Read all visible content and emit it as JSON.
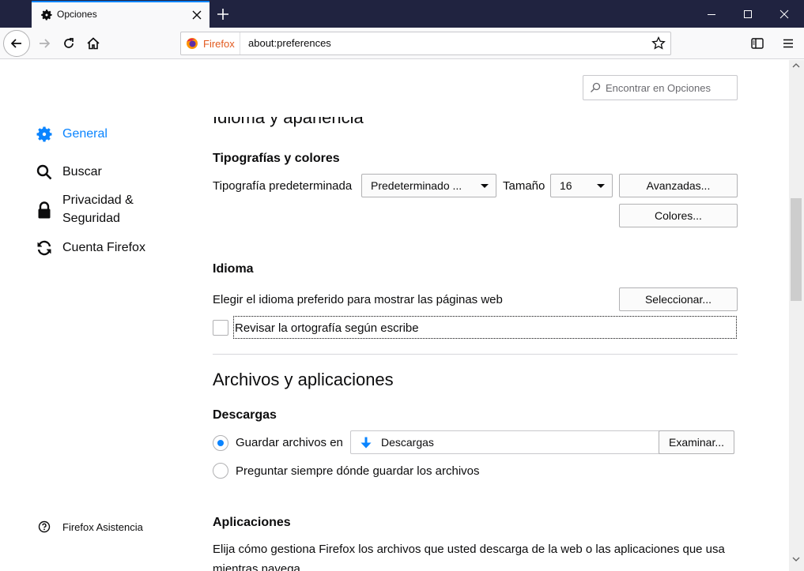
{
  "browser": {
    "tab_title": "Opciones",
    "identity_label": "Firefox",
    "url": "about:preferences"
  },
  "search": {
    "placeholder": "Encontrar en Opciones"
  },
  "sidebar": {
    "items": [
      {
        "label": "General",
        "icon": "gear-icon",
        "active": true
      },
      {
        "label": "Buscar",
        "icon": "search-icon"
      },
      {
        "label": "Privacidad &\nSeguridad",
        "icon": "lock-icon"
      },
      {
        "label": "Cuenta Firefox",
        "icon": "sync-icon"
      }
    ],
    "help_label": "Firefox Asistencia"
  },
  "main": {
    "clipped_heading": "Idioma y apariencia",
    "fonts": {
      "heading": "Tipografías y colores",
      "default_font_label": "Tipografía predeterminada",
      "default_font_value": "Predeterminado ...",
      "size_label": "Tamaño",
      "size_value": "16",
      "advanced_button": "Avanzadas...",
      "colors_button": "Colores..."
    },
    "language": {
      "heading": "Idioma",
      "description": "Elegir el idioma preferido para mostrar las páginas web",
      "select_button": "Seleccionar...",
      "spellcheck_label": "Revisar la ortografía según escribe",
      "spellcheck_checked": false
    },
    "files_apps": {
      "heading": "Archivos y aplicaciones",
      "downloads_heading": "Descargas",
      "save_files_label": "Guardar archivos en",
      "save_files_checked": true,
      "folder_name": "Descargas",
      "browse_button": "Examinar...",
      "always_ask_label": "Preguntar siempre dónde guardar los archivos",
      "always_ask_checked": false,
      "apps_heading": "Aplicaciones",
      "apps_description": "Elija cómo gestiona Firefox los archivos que usted descarga de la web o las aplicaciones que usa",
      "apps_description_cont": "mientras navega."
    }
  },
  "colors": {
    "accent": "#0a84ff",
    "titlebar": "#202340",
    "text": "#0c0c0d",
    "border": "#b1b1b3"
  }
}
